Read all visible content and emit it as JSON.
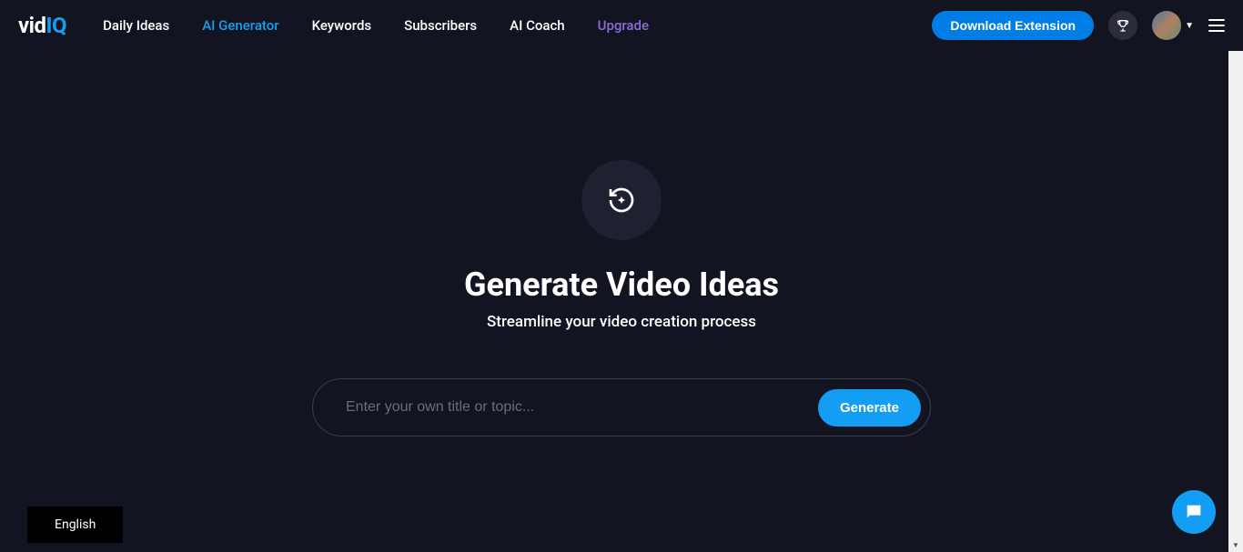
{
  "header": {
    "logo": {
      "part1": "vid",
      "part2": "IQ"
    },
    "nav": [
      {
        "label": "Daily Ideas",
        "active": false
      },
      {
        "label": "AI Generator",
        "active": true
      },
      {
        "label": "Keywords",
        "active": false
      },
      {
        "label": "Subscribers",
        "active": false
      },
      {
        "label": "AI Coach",
        "active": false
      },
      {
        "label": "Upgrade",
        "active": false,
        "upgrade": true
      }
    ],
    "download_label": "Download Extension"
  },
  "main": {
    "heading": "Generate Video Ideas",
    "subheading": "Streamline your video creation process",
    "input_placeholder": "Enter your own title or topic...",
    "generate_label": "Generate"
  },
  "footer": {
    "language": "English"
  }
}
